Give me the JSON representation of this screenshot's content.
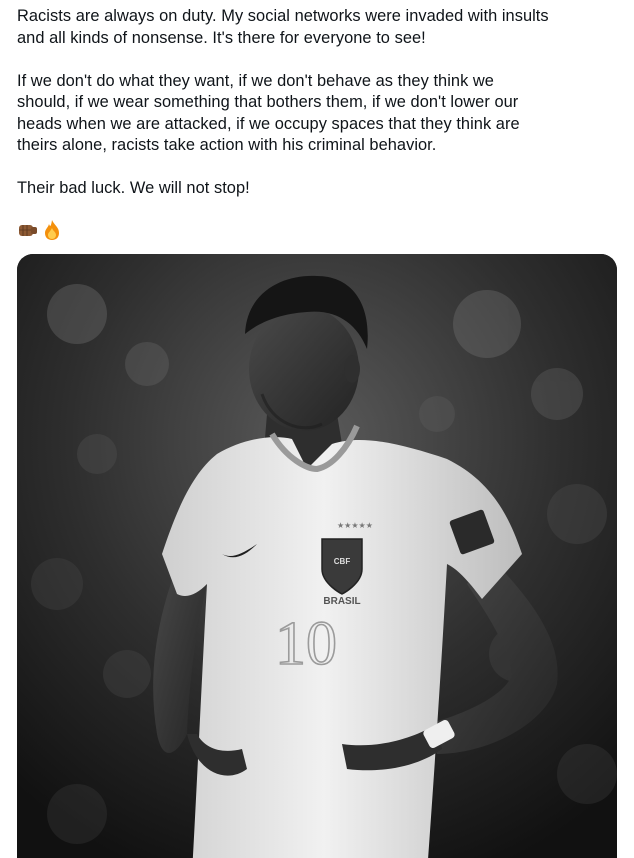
{
  "tweet": {
    "paragraphs": [
      {
        "lines": [
          "Racists are always on duty. My social networks were invaded with insults",
          "and all kinds of nonsense. It's there for everyone to see!"
        ]
      },
      {
        "lines": [
          "If we don't do what they want, if we don't behave as they think we",
          "should, if we wear something that bothers them, if we don't lower our",
          "heads when we are attacked, if we occupy spaces that they think are",
          "theirs alone, racists take action with his criminal behavior."
        ]
      },
      {
        "lines": [
          "Their bad luck. We will not stop!"
        ]
      }
    ],
    "emojis": [
      "fist-bump-icon",
      "fire-icon"
    ]
  },
  "media": {
    "jersey_crest_text": "CBF",
    "jersey_country_text": "BRASIL",
    "jersey_number": "10",
    "colors": {
      "background_dark": "#1a1a1a",
      "shirt": "#e9e9e9",
      "skin": "#3a3a3a"
    }
  }
}
